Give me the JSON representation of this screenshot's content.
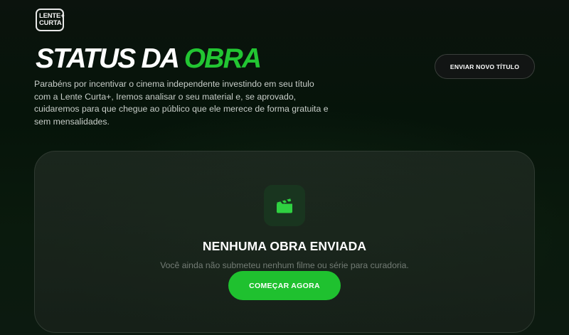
{
  "logo": {
    "line1": "LENTE+",
    "line2": "CURTA"
  },
  "header": {
    "title_part1": "STATUS DA ",
    "title_part2": "OBRA",
    "description": "Parabéns por incentivar o cinema independente investindo em seu título com a Lente Curta+, Iremos analisar o seu material e, se aprovado, cuidaremos para que chegue ao público que ele merece de forma gratuita e sem mensalidades.",
    "send_button": "ENVIAR NOVO TÍTULO"
  },
  "empty_state": {
    "icon": "clapperboard-icon",
    "title": "NENHUMA OBRA ENVIADA",
    "subtitle": "Você ainda não submeteu nenhum filme ou série para curadoria.",
    "cta": "COMEÇAR AGORA"
  },
  "colors": {
    "accent": "#1fc12f",
    "background": "#0a150c",
    "card": "#1c261e"
  }
}
